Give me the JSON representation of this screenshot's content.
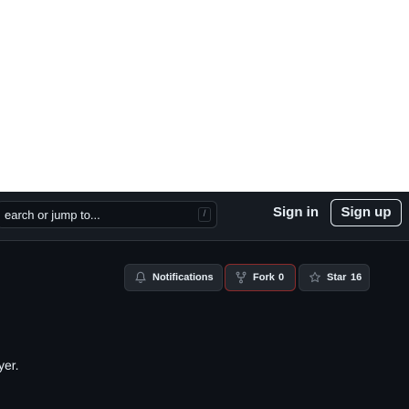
{
  "header": {
    "search_placeholder": "earch or jump to...",
    "search_key_hint": "/",
    "signin_label": "Sign in",
    "signup_label": "Sign up"
  },
  "actions": {
    "notifications_label": "Notifications",
    "fork_label": "Fork",
    "fork_count": "0",
    "star_label": "Star",
    "star_count": "16"
  },
  "body": {
    "tail_text": "yer."
  },
  "colors": {
    "page_bg": "#0d1117",
    "header_bg": "#161b22",
    "border": "#30363d",
    "text": "#e6edf3",
    "fork_outline": "#8b2b2b"
  }
}
